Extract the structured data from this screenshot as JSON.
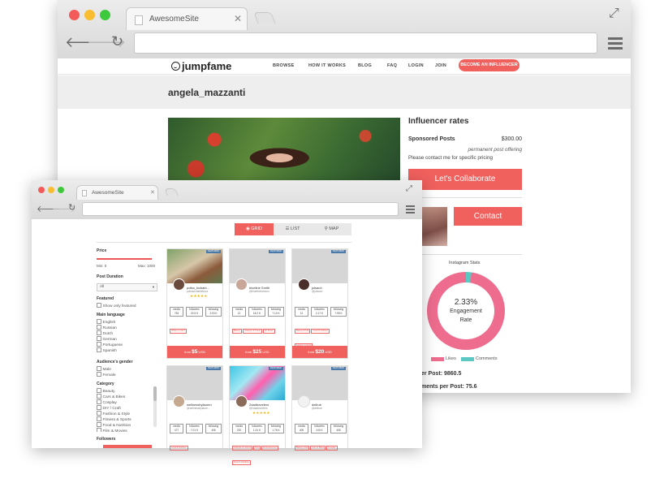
{
  "browser": {
    "tab_title": "AwesomeSite"
  },
  "site": {
    "logo": "jumpfame",
    "nav": [
      "BROWSE",
      "HOW IT WORKS",
      "BLOG",
      "FAQ",
      "LOGIN",
      "JOIN"
    ],
    "cta": "BECOME AN INFLUENCER"
  },
  "profile": {
    "username": "angela_mazzanti",
    "rates": {
      "title": "Influencer rates",
      "sponsored_label": "Sponsored Posts",
      "sponsored_price": "$300.00",
      "note": "permanent post offering",
      "contact_text": "Please contact me for specific pricing"
    },
    "collab_button": "Let's Collaborate",
    "contact_button": "Contact",
    "stats": {
      "title": "Instagram Stats",
      "engagement_pct": 2.33,
      "engagement_value": "2.33%",
      "engagement_label_1": "Engagement",
      "engagement_label_2": "Rate",
      "legend": [
        "Likes",
        "Comments"
      ],
      "colors": {
        "likes": "#ee6c8e",
        "comments": "#5cc8c3"
      },
      "likes_line": "er Post: 9860.5",
      "comments_line": "ments per Post: 75.6"
    }
  },
  "listing": {
    "view_tabs": [
      "GRID",
      "LIST",
      "MAP"
    ],
    "filters": {
      "price_title": "Price",
      "price_min": "Min: 0",
      "price_max": "Max: 1000",
      "duration_title": "Post Duration",
      "duration_value": "All",
      "featured_title": "Featured",
      "featured_option": "Show only featured",
      "language_title": "Main language",
      "languages": [
        "English",
        "Russian",
        "Dutch",
        "German",
        "Portuguese",
        "Spanish"
      ],
      "gender_title": "Audience's gender",
      "genders": [
        "Male",
        "Female"
      ],
      "category_title": "Category",
      "categories": [
        "Beauty",
        "Cars & Bikes",
        "Cosplay",
        "DIY / Craft",
        "Fashion & Style",
        "Fitness & Sports",
        "Food & Nutrition",
        "Film & Movies"
      ],
      "followers_title": "Followers"
    },
    "cards": [
      {
        "badge": "FEATURED",
        "name": "polka_lovbabi...",
        "handle": "polkalovbabiebuzz",
        "stars": "★★★★★",
        "stats": [
          [
            "media",
            "763"
          ],
          [
            "followers",
            "23.5 K"
          ],
          [
            "following",
            "3.53 K"
          ]
        ],
        "tags": [
          "Where to lnk it"
        ],
        "price_prefix": "from",
        "price": "$5",
        "price_suffix": "USD"
      },
      {
        "badge": "FEATURED",
        "name": "blueline Smith",
        "handle": "@bluelinefamous",
        "stars": "",
        "stats": [
          [
            "media",
            "12"
          ],
          [
            "followers",
            "18.2 K"
          ],
          [
            "following",
            "7.10 K"
          ]
        ],
        "tags": [
          "Beauty",
          "Lifestyle & Travel",
          "Art Music"
        ],
        "price_prefix": "from",
        "price": "$25",
        "price_suffix": "USD"
      },
      {
        "badge": "FEATURED",
        "name": "julsauh",
        "handle": "@julsauh",
        "stars": "",
        "stats": [
          [
            "media",
            "12"
          ],
          [
            "followers",
            "2.17 K"
          ],
          [
            "following",
            "7.95 K"
          ]
        ],
        "tags": [
          "Beauty & Life",
          "Food & Nutrition",
          "Fashion & Style"
        ],
        "price_prefix": "from",
        "price": "$20",
        "price_suffix": "USD"
      },
      {
        "badge": "FEATURED",
        "name": "wellnessbylauren",
        "handle": "@wellnessbylaure...",
        "stars": "",
        "stats": [
          [
            "media",
            "477"
          ],
          [
            "followers",
            "7.01 K"
          ],
          [
            "following",
            "406"
          ]
        ],
        "tags": [
          "Food & Nutrition"
        ],
        "price_prefix": "",
        "price": "",
        "price_suffix": ""
      },
      {
        "badge": "FEATURED",
        "name": "2dadtravelers",
        "handle": "@2dadtravelers",
        "stars": "★★★★★",
        "stats": [
          [
            "media",
            "220"
          ],
          [
            "followers",
            "1.31 K"
          ],
          [
            "following",
            "1.76 K"
          ]
        ],
        "tags": [
          "Lifestyle & Leisure",
          "Pets",
          "Entertainment",
          "Food & Nutrition"
        ],
        "price_prefix": "",
        "price": "",
        "price_suffix": ""
      },
      {
        "badge": "FEATURED",
        "name": "dellrub",
        "handle": "@dellrub",
        "stars": "",
        "stats": [
          [
            "media",
            "409"
          ],
          [
            "followers",
            "240 K"
          ],
          [
            "following",
            "406"
          ]
        ],
        "tags": [
          "Beauty Goal",
          "Cars & Bikes",
          "Cosplay"
        ],
        "price_prefix": "",
        "price": "",
        "price_suffix": ""
      }
    ]
  }
}
